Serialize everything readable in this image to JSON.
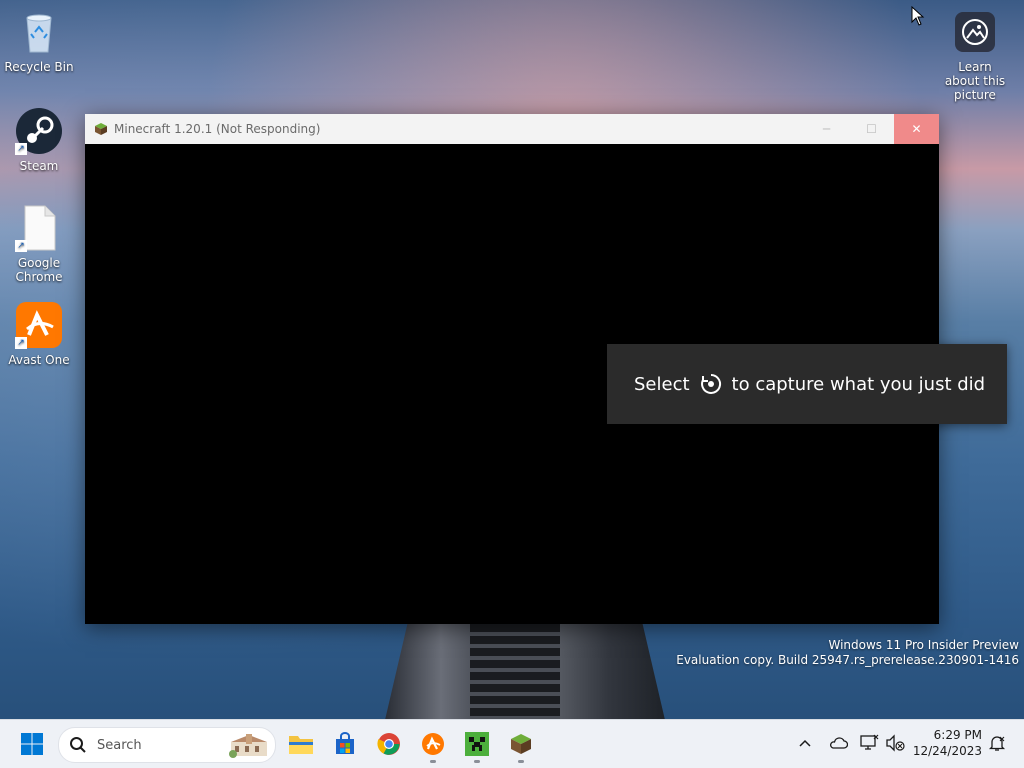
{
  "desktop": {
    "icons": [
      {
        "label": "Recycle Bin",
        "icon": "recycle-bin-icon"
      },
      {
        "label": "Steam",
        "icon": "steam-icon"
      },
      {
        "label": "Google Chrome",
        "icon": "file-shortcut-icon"
      },
      {
        "label": "Avast One",
        "icon": "avast-icon"
      }
    ],
    "learn_label": "Learn about this picture"
  },
  "window": {
    "title": "Minecraft 1.20.1 (Not Responding)"
  },
  "toast": {
    "before": "Select",
    "after": "to capture what you just did"
  },
  "watermark": {
    "line1": "Windows 11 Pro Insider Preview",
    "line2": "Evaluation copy. Build 25947.rs_prerelease.230901-1416"
  },
  "taskbar": {
    "search_placeholder": "Search",
    "apps": [
      "file-explorer-icon",
      "microsoft-store-icon",
      "chrome-icon",
      "avast-icon",
      "minecraft-creeper-icon",
      "minecraft-grass-block-icon"
    ],
    "time": "6:29 PM",
    "date": "12/24/2023"
  },
  "colors": {
    "titlebar": "#f3f3f3",
    "close_button": "#f08a8a",
    "toast_bg": "#2b2b2b",
    "taskbar_bg": "#eef1f6"
  }
}
